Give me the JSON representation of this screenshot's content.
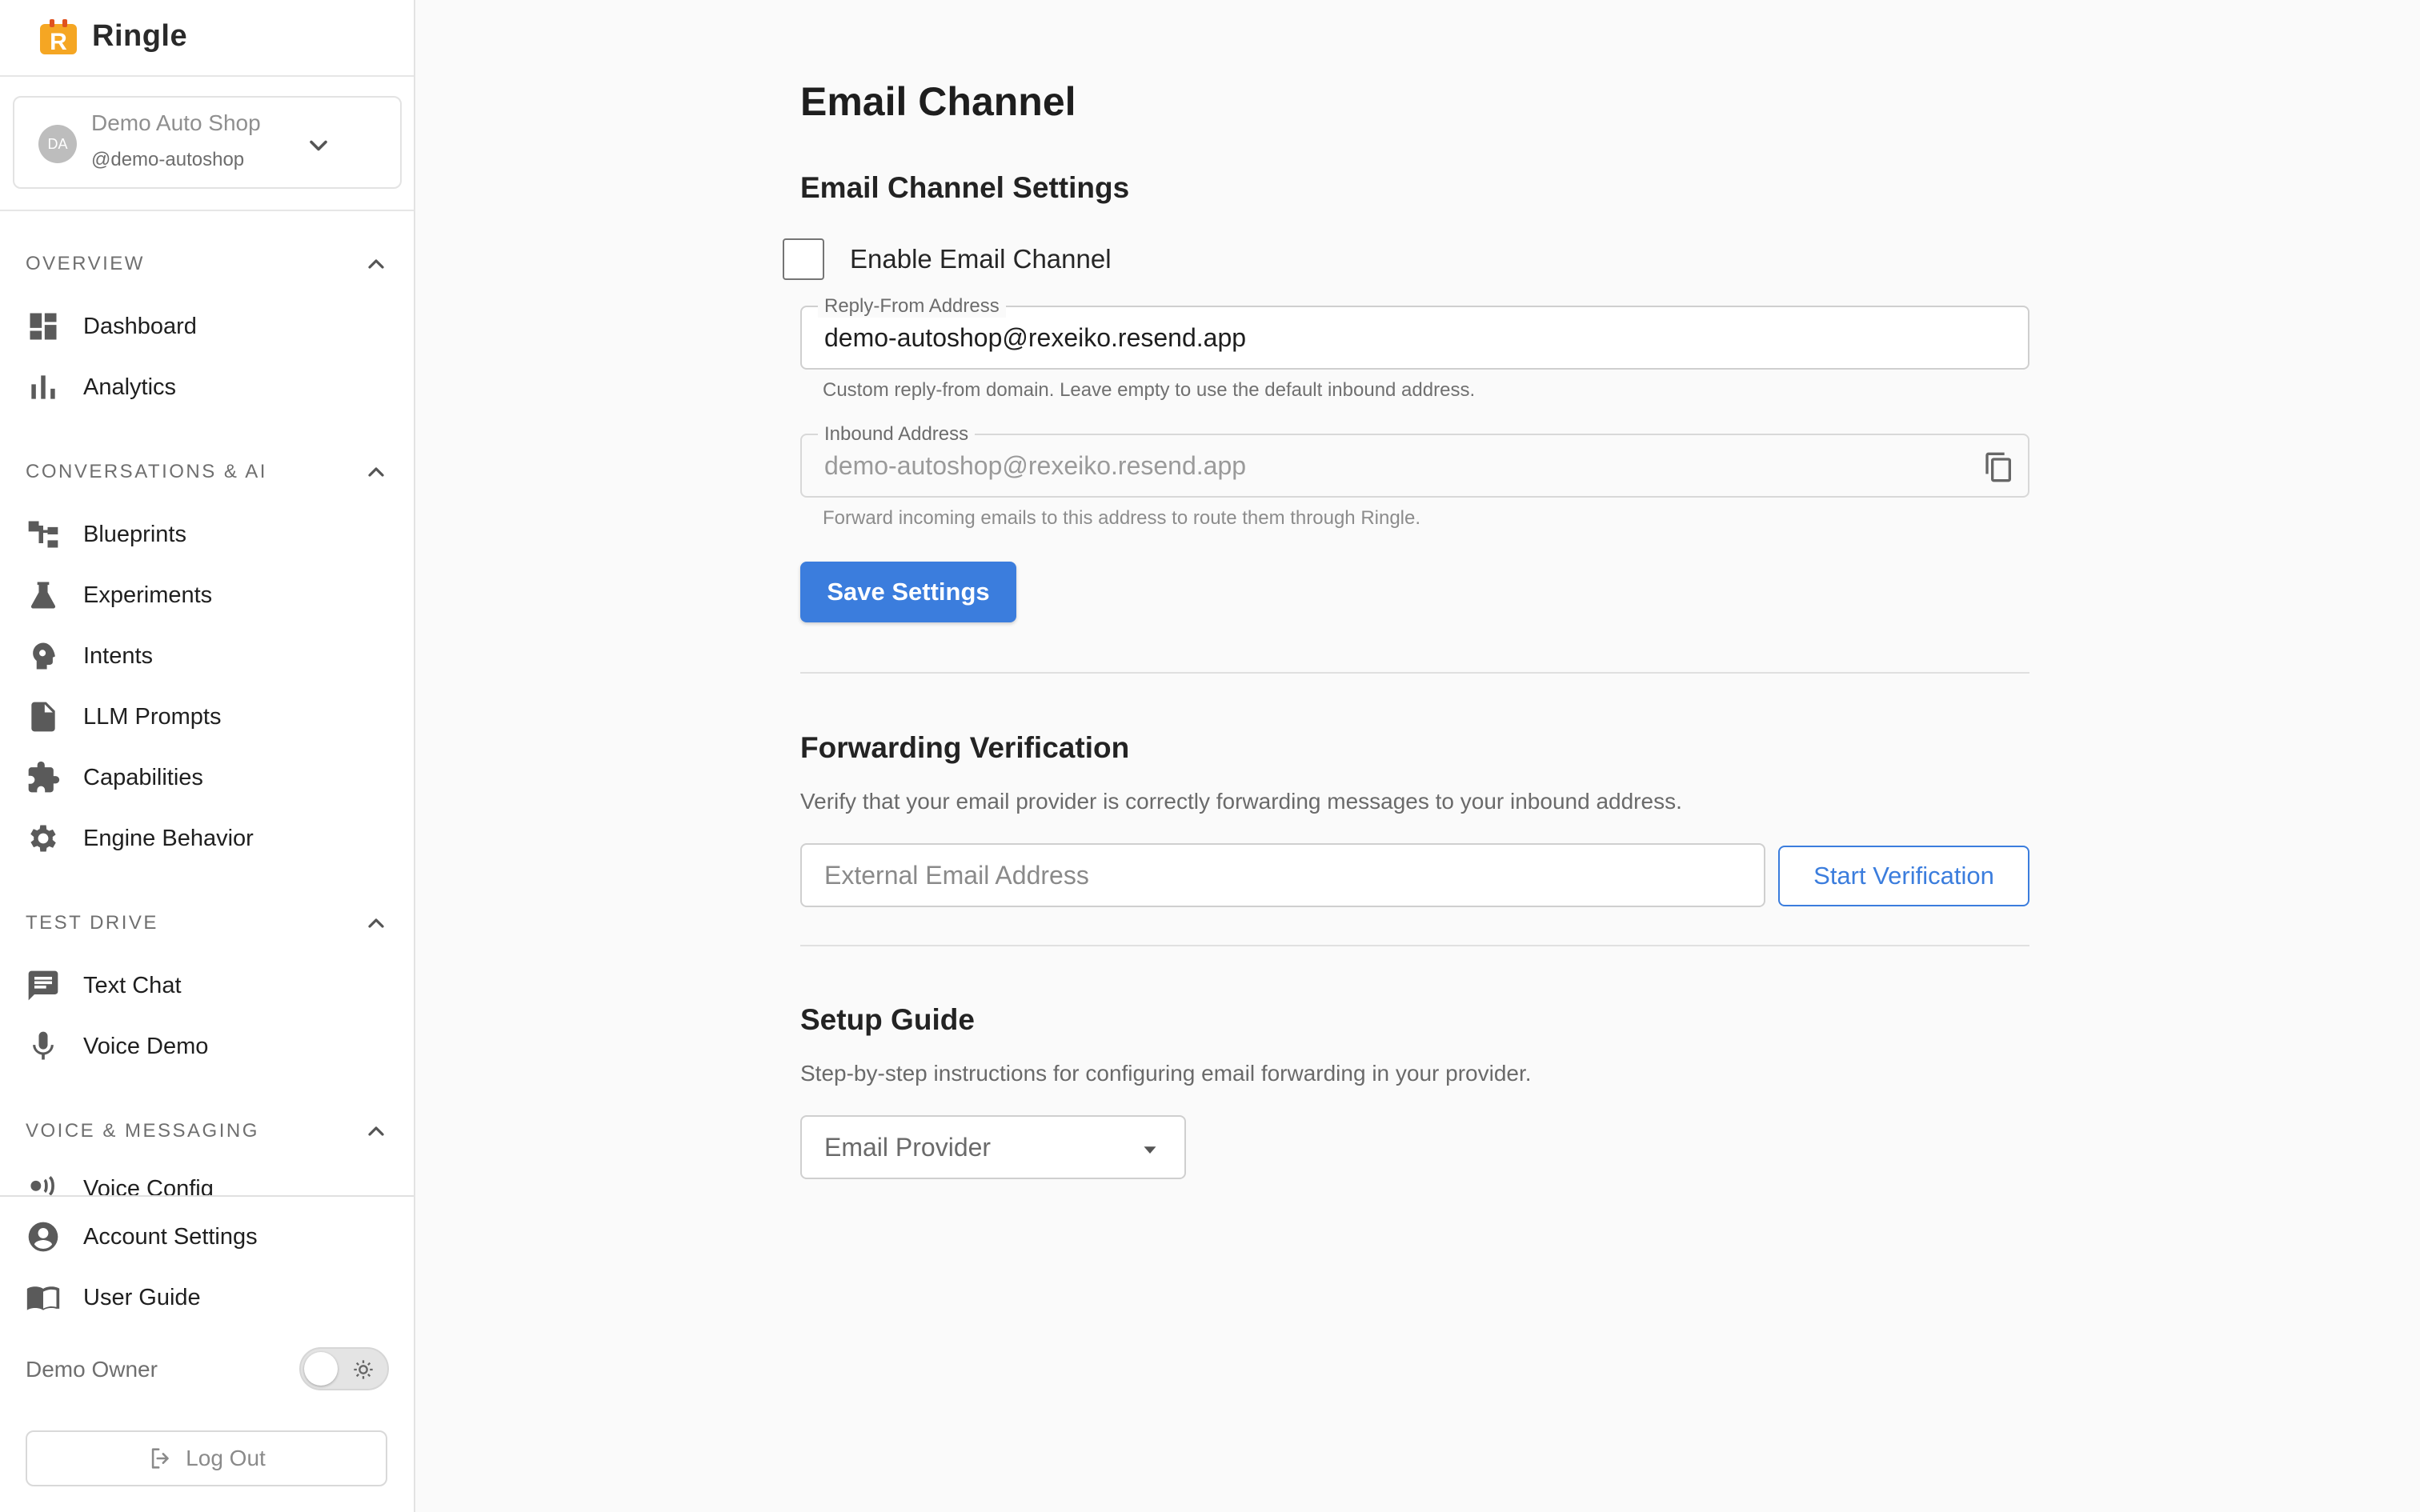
{
  "brand": {
    "name": "Ringle",
    "logo_letter": "R",
    "color": "#f5a623"
  },
  "workspace": {
    "initials": "DA",
    "name": "Demo Auto Shop",
    "handle": "@demo-autoshop"
  },
  "nav": {
    "overview": {
      "label": "OVERVIEW",
      "items": [
        {
          "label": "Dashboard",
          "icon": "dashboard-icon"
        },
        {
          "label": "Analytics",
          "icon": "bar-chart-icon"
        }
      ]
    },
    "conversations": {
      "label": "CONVERSATIONS & AI",
      "items": [
        {
          "label": "Blueprints",
          "icon": "blueprint-tree-icon"
        },
        {
          "label": "Experiments",
          "icon": "flask-icon"
        },
        {
          "label": "Intents",
          "icon": "head-gear-icon"
        },
        {
          "label": "LLM Prompts",
          "icon": "document-icon"
        },
        {
          "label": "Capabilities",
          "icon": "puzzle-icon"
        },
        {
          "label": "Engine Behavior",
          "icon": "gear-icon"
        }
      ]
    },
    "test_drive": {
      "label": "TEST DRIVE",
      "items": [
        {
          "label": "Text Chat",
          "icon": "chat-icon"
        },
        {
          "label": "Voice Demo",
          "icon": "microphone-icon"
        }
      ]
    },
    "voice_messaging": {
      "label": "VOICE & MESSAGING",
      "items": [
        {
          "label": "Voice Config",
          "icon": "voice-icon"
        }
      ]
    }
  },
  "footer": {
    "account_settings": "Account Settings",
    "user_guide": "User Guide",
    "owner": "Demo Owner",
    "logout": "Log Out"
  },
  "page": {
    "title": "Email Channel",
    "settings": {
      "heading": "Email Channel Settings",
      "enable_label": "Enable Email Channel",
      "enabled": false,
      "reply_from": {
        "label": "Reply-From Address",
        "value": "demo-autoshop@rexeiko.resend.app",
        "helper": "Custom reply-from domain. Leave empty to use the default inbound address."
      },
      "inbound": {
        "label": "Inbound Address",
        "value": "demo-autoshop@rexeiko.resend.app",
        "helper": "Forward incoming emails to this address to route them through Ringle."
      },
      "save_label": "Save Settings"
    },
    "forwarding": {
      "heading": "Forwarding Verification",
      "description": "Verify that your email provider is correctly forwarding messages to your inbound address.",
      "input_placeholder": "External Email Address",
      "button_label": "Start Verification"
    },
    "setup": {
      "heading": "Setup Guide",
      "description": "Step-by-step instructions for configuring email forwarding in your provider.",
      "select_placeholder": "Email Provider"
    }
  },
  "colors": {
    "accent": "#3b7ddd",
    "sidebar_bg": "#ffffff",
    "main_bg": "#fafafa"
  }
}
